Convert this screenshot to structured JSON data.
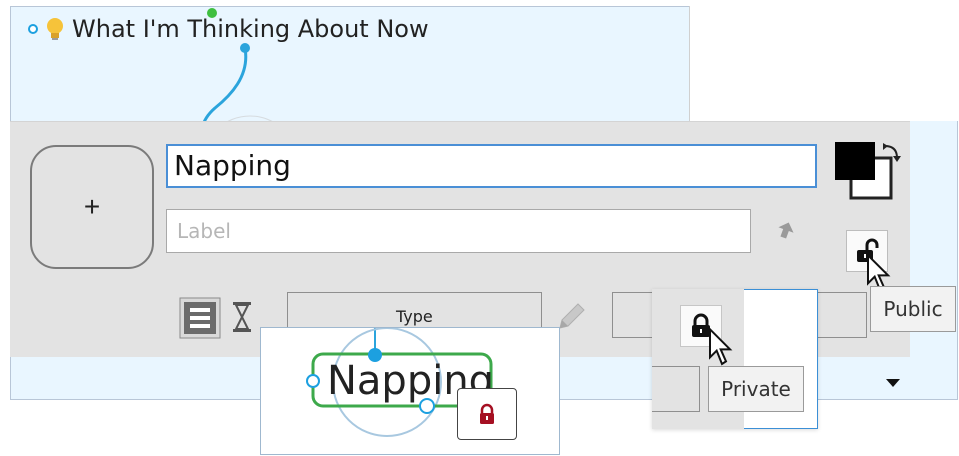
{
  "thought": {
    "title": "What I'm Thinking About Now"
  },
  "editor": {
    "add_button_label": "+",
    "name_value": "Napping",
    "label_placeholder": "Label",
    "type_label": "Type"
  },
  "privacy": {
    "public_tooltip": "Public",
    "private_tooltip": "Private"
  },
  "inset": {
    "node_name": "Napping"
  },
  "icons": {
    "bulb": "lightbulb-icon",
    "pin": "pin-icon",
    "swatch": "color-swatch-icon",
    "unlock": "unlock-icon",
    "lock": "lock-icon",
    "notes": "notes-icon",
    "timer": "hourglass-icon",
    "pencil": "pencil-icon",
    "dropdown": "chevron-down-icon",
    "cursor": "mouse-cursor-icon"
  },
  "colors": {
    "accent": "#1ca0e0",
    "node_outline": "#3da94b",
    "private_lock": "#a50f22",
    "panel_bg": "#e3e3e3"
  }
}
